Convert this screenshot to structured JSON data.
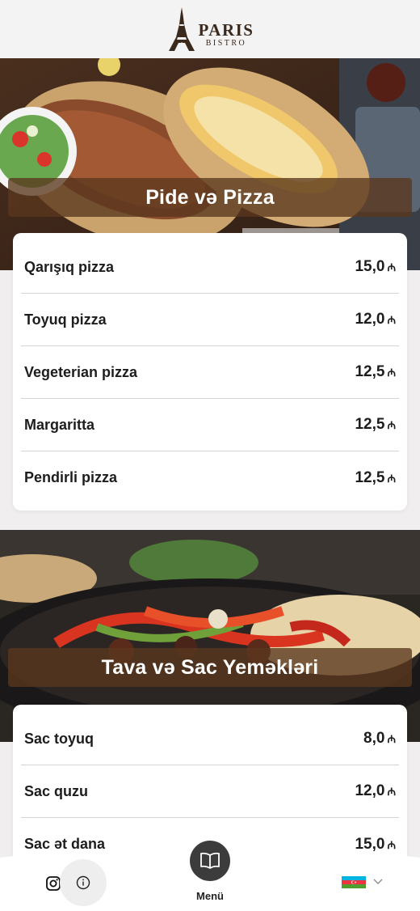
{
  "header": {
    "logo_title": "PARIS",
    "logo_subtitle": "BISTRO"
  },
  "sections": [
    {
      "title": "Pide və Pizza",
      "items": [
        {
          "name": "Qarışıq pizza",
          "price": "15,0"
        },
        {
          "name": "Toyuq pizza",
          "price": "12,0"
        },
        {
          "name": "Vegeterian pizza",
          "price": "12,5"
        },
        {
          "name": "Margaritta",
          "price": "12,5"
        },
        {
          "name": "Pendirli pizza",
          "price": "12,5"
        }
      ]
    },
    {
      "title": "Tava və Sac Yeməkləri",
      "items": [
        {
          "name": "Sac toyuq",
          "price": "8,0"
        },
        {
          "name": "Sac quzu",
          "price": "12,0"
        },
        {
          "name": "Sac ət dana",
          "price": "15,0"
        }
      ]
    }
  ],
  "currency_symbol": "₼",
  "bottom_nav": {
    "menu_label": "Menü",
    "instagram_icon": "instagram-icon",
    "info_icon": "info-icon",
    "menu_icon": "book-icon",
    "language_flag": "azerbaijan-flag"
  },
  "colors": {
    "banner": "#5a371e",
    "flag_blue": "#00b5e2",
    "flag_red": "#ef3340",
    "flag_green": "#509e2f"
  }
}
